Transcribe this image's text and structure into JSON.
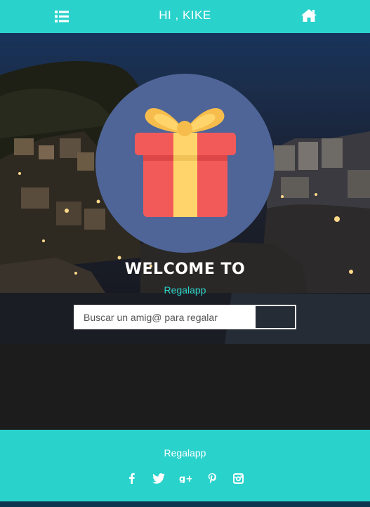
{
  "colors": {
    "accent": "#2ad2cc",
    "circle": "#4f6597",
    "footer_strip": "#0d3550"
  },
  "header": {
    "greeting": "HI , KIKE",
    "menu_icon": "list-icon",
    "home_icon": "home-icon"
  },
  "hero": {
    "welcome": "WELCOME TO",
    "app_name": "Regalapp",
    "gift_icon": "gift-icon"
  },
  "search": {
    "placeholder": "Buscar un amig@ para regalar",
    "button_label": ""
  },
  "footer": {
    "brand": "Regalapp",
    "social": [
      "facebook-icon",
      "twitter-icon",
      "google-plus-icon",
      "pinterest-icon",
      "instagram-icon"
    ]
  }
}
